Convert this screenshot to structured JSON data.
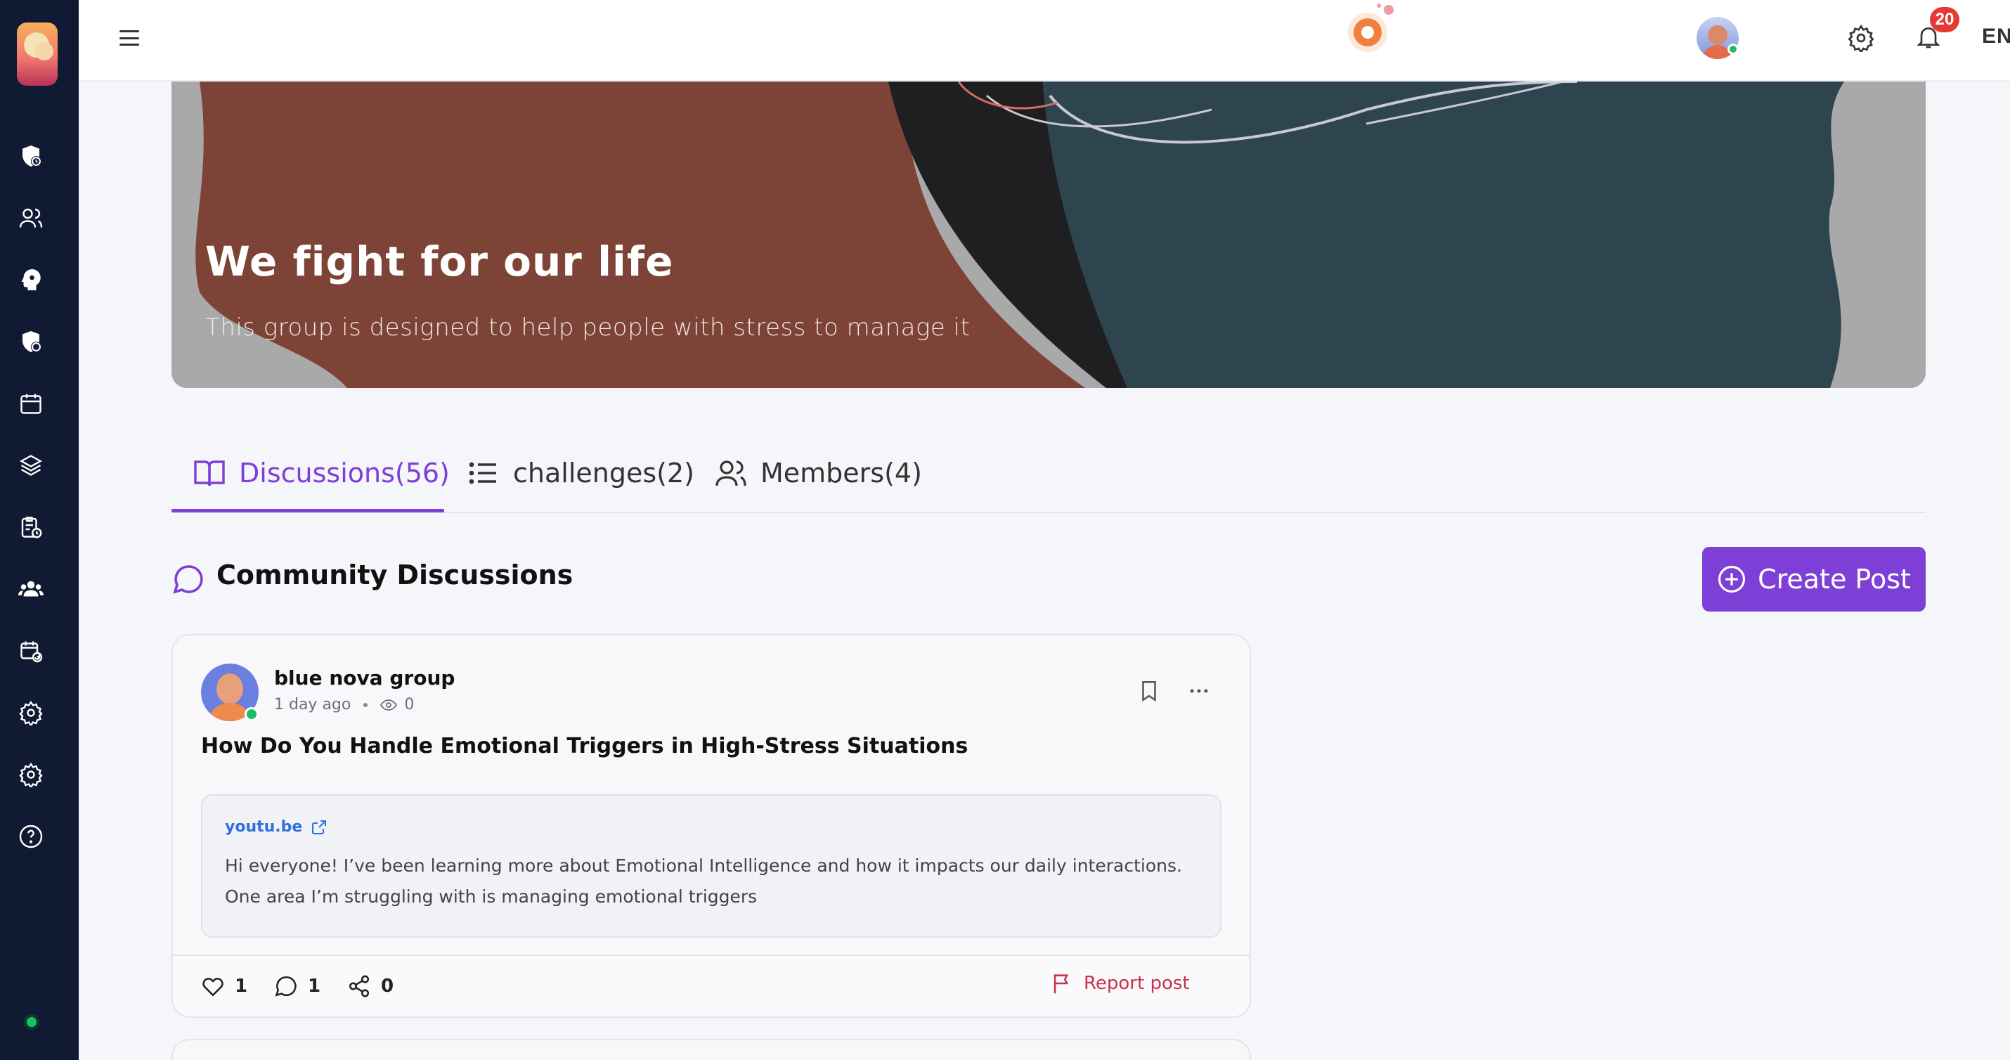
{
  "sidebar": {
    "icons": [
      "shield-clock-icon",
      "users-icon",
      "brain-icon",
      "shield-clock-icon",
      "calendar-icon",
      "layers-icon",
      "clipboard-clock-icon",
      "group-icon",
      "calendar-refresh-icon",
      "gear-icon",
      "gear-icon",
      "help-icon"
    ],
    "status_color": "#1bbf6a"
  },
  "topbar": {
    "notification_count": "20",
    "language": "ENG"
  },
  "banner": {
    "title": "We fight for our life",
    "subtitle": "This group is designed to help people with stress to manage it"
  },
  "tabs": [
    {
      "label": "Discussions(56)",
      "icon": "book-icon",
      "active": true
    },
    {
      "label": "challenges(2)",
      "icon": "list-icon",
      "active": false
    },
    {
      "label": "Members(4)",
      "icon": "users-icon",
      "active": false
    }
  ],
  "section": {
    "title": "Community Discussions",
    "create_label": "Create Post"
  },
  "post": {
    "author": "blue nova group",
    "time": "1 day ago",
    "views": "0",
    "title": "How Do You Handle Emotional Triggers in High-Stress Situations",
    "link_source": "youtu.be",
    "link_text": "Hi everyone!  I’ve been learning more about Emotional Intelligence and how it impacts our daily interactions. One area I’m struggling with is managing emotional triggers",
    "likes": "1",
    "comments": "1",
    "shares": "0",
    "report_label": "Report post"
  },
  "colors": {
    "accent": "#7e3fd6",
    "sidebar": "#101a33",
    "report": "#c8324a",
    "link": "#2f6fe0"
  }
}
